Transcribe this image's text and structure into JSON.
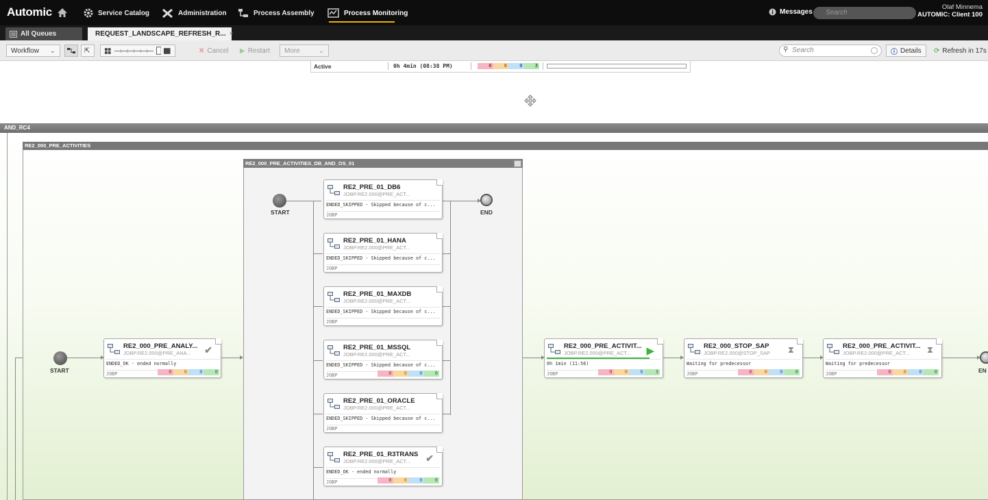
{
  "topbar": {
    "brand": "Automic",
    "nav": [
      "Service Catalog",
      "Administration",
      "Process Assembly",
      "Process Monitoring"
    ],
    "messages_label": "Messages",
    "search_placeholder": "Search",
    "user_name": "Olaf Minnema",
    "client": "AUTOMIC: Client 100"
  },
  "tabs": {
    "queues": "All Queues",
    "request": "REQUEST_LANDSCAPE_REFRESH_R...",
    "close": "×"
  },
  "toolbar": {
    "view_select": "Workflow",
    "cancel": "Cancel",
    "restart": "Restart",
    "more": "More",
    "search_placeholder": "Search",
    "details": "Details",
    "refresh": "Refresh in 17s"
  },
  "status_row": {
    "state": "Active",
    "time": "0h 4min (08:38 PM)",
    "counts": [
      "0",
      "0",
      "0",
      "3"
    ]
  },
  "workflow": {
    "outer_label": "AND_RC4",
    "pre_title": "RE2_000_PRE_ACTIVITIES",
    "db_title": "RE2_000_PRE_ACTIVITIES_DB_AND_OS_01",
    "start": "START",
    "end": "END",
    "end_cut": "EN"
  },
  "cards": {
    "analy": {
      "name": "RE2_000_PRE_ANALY...",
      "object": "JOBP.RE2.000@PRE_ANA...",
      "status": "ENDED_OK - ended normally",
      "type": "JOBP",
      "counts": [
        "0",
        "0",
        "0",
        "0"
      ]
    },
    "db6": {
      "name": "RE2_PRE_01_DB6",
      "object": "JOBP.RE2.000@PRE_ACT...",
      "status": "ENDED_SKIPPED - Skipped because of c...",
      "type": "JOBP"
    },
    "hana": {
      "name": "RE2_PRE_01_HANA",
      "object": "JOBP.RE2.000@PRE_ACT...",
      "status": "ENDED_SKIPPED - Skipped because of c...",
      "type": "JOBP"
    },
    "maxdb": {
      "name": "RE2_PRE_01_MAXDB",
      "object": "JOBP.RE2.000@PRE_ACT...",
      "status": "ENDED_SKIPPED - Skipped because of c...",
      "type": "JOBP"
    },
    "mssql": {
      "name": "RE2_PRE_01_MSSQL",
      "object": "JOBP.RE2.000@PRE_ACT...",
      "status": "ENDED_SKIPPED - Skipped because of c...",
      "type": "JOBP",
      "counts": [
        "0",
        "0",
        "0",
        "0"
      ]
    },
    "oracle": {
      "name": "RE2_PRE_01_ORACLE",
      "object": "JOBP.RE2.000@PRE_ACT...",
      "status": "ENDED_SKIPPED - Skipped because of c...",
      "type": "JOBP"
    },
    "r3trans": {
      "name": "RE2_PRE_01_R3TRANS",
      "object": "JOBP.RE2.000@PRE_ACT...",
      "status": "ENDED_OK - ended normally",
      "type": "JOBP",
      "counts": [
        "0",
        "0",
        "0",
        "0"
      ]
    },
    "activ1": {
      "name": "RE2_000_PRE_ACTIVIT...",
      "object": "JOBP.RE2.000@PRE_ACT...",
      "status": "0h 1min (11:56)",
      "type": "JOBP",
      "counts": [
        "0",
        "0",
        "0",
        "3"
      ]
    },
    "stopsap": {
      "name": "RE2_000_STOP_SAP",
      "object": "JOBP.RE2.000@STOP_SAP",
      "status": "Waiting for predecessor",
      "type": "JOBP",
      "counts": [
        "0",
        "0",
        "0",
        "0"
      ]
    },
    "activ2": {
      "name": "RE2_000_PRE_ACTIVIT...",
      "object": "JOBP.RE2.000@PRE_ACT...",
      "status": "Waiting for predecessor",
      "type": "JOBP",
      "counts": [
        "0",
        "0",
        "0",
        "0"
      ]
    }
  },
  "colors": {
    "accent": "#f0b400",
    "running": "#3cb33c",
    "topbar": "#0d0d0d"
  }
}
